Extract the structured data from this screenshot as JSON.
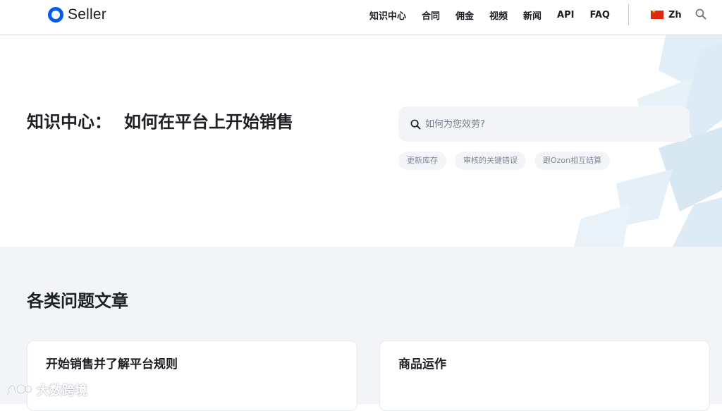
{
  "brand": {
    "name": "Seller",
    "accent": "#005bff"
  },
  "nav": {
    "items": [
      "知识中心",
      "合同",
      "佣金",
      "视频",
      "新闻",
      "API",
      "FAQ"
    ],
    "language": "Zh",
    "language_flag": "china-flag-icon"
  },
  "hero": {
    "title_prefix": "知识中心：",
    "title_main": "如何在平台上开始销售",
    "search_placeholder": "如何为您效劳?",
    "chips": [
      "更新库存",
      "审核的关键错误",
      "跟Ozon相互结算"
    ]
  },
  "categories": {
    "title": "各类问题文章",
    "cards": [
      {
        "title": "开始销售并了解平台规则"
      },
      {
        "title": "商品运作"
      }
    ]
  },
  "watermark": {
    "text": "大数跨境"
  },
  "colors": {
    "text": "#1c1f24",
    "section_bg": "#f2f4f7",
    "hero_art": "#dcebf5"
  }
}
